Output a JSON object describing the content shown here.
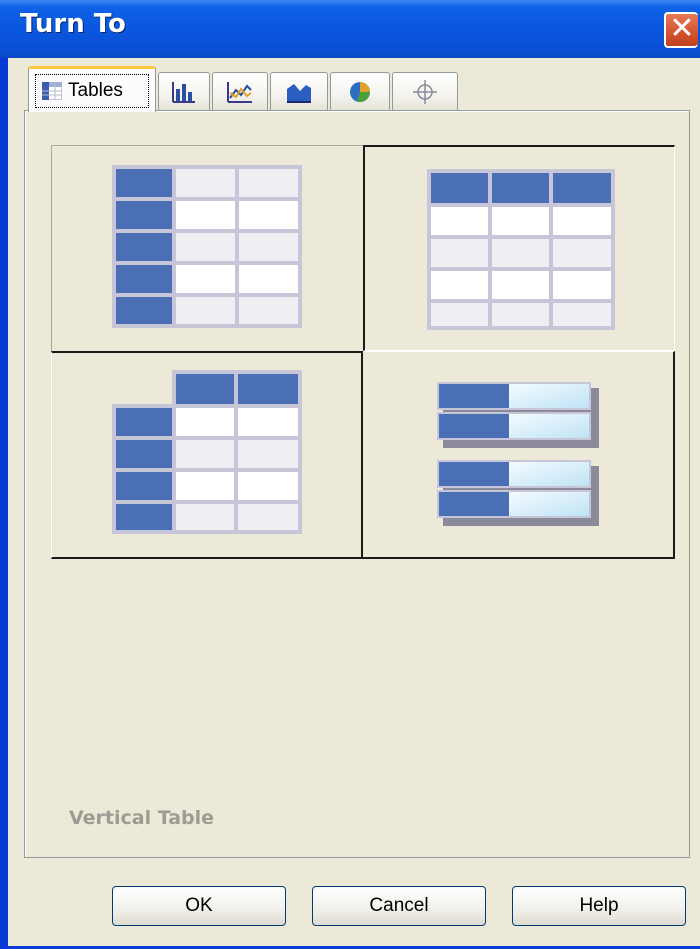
{
  "window": {
    "title": "Turn To",
    "close_label": "✕"
  },
  "tabs": [
    {
      "label": "Tables",
      "icon": "table-icon",
      "active": true
    },
    {
      "label": "",
      "icon": "bar-chart-icon"
    },
    {
      "label": "",
      "icon": "line-chart-icon"
    },
    {
      "label": "",
      "icon": "area-chart-icon"
    },
    {
      "label": "",
      "icon": "pie-chart-icon"
    },
    {
      "label": "",
      "icon": "crosshair-icon"
    }
  ],
  "options": [
    {
      "name": "vertical-table",
      "selected": false
    },
    {
      "name": "horizontal-table",
      "selected": true
    },
    {
      "name": "crosstab-table",
      "selected": false
    },
    {
      "name": "list-table",
      "selected": false
    }
  ],
  "caption": "Vertical Table",
  "buttons": {
    "ok": "OK",
    "cancel": "Cancel",
    "help": "Help"
  },
  "colors": {
    "title_bar": "#0a58df",
    "header_blue": "#4a6fb5",
    "cell_white": "#ffffff",
    "cell_gray": "#efeff3",
    "grid_line": "#c6c6d8",
    "caption_gray": "#9d9c93"
  }
}
